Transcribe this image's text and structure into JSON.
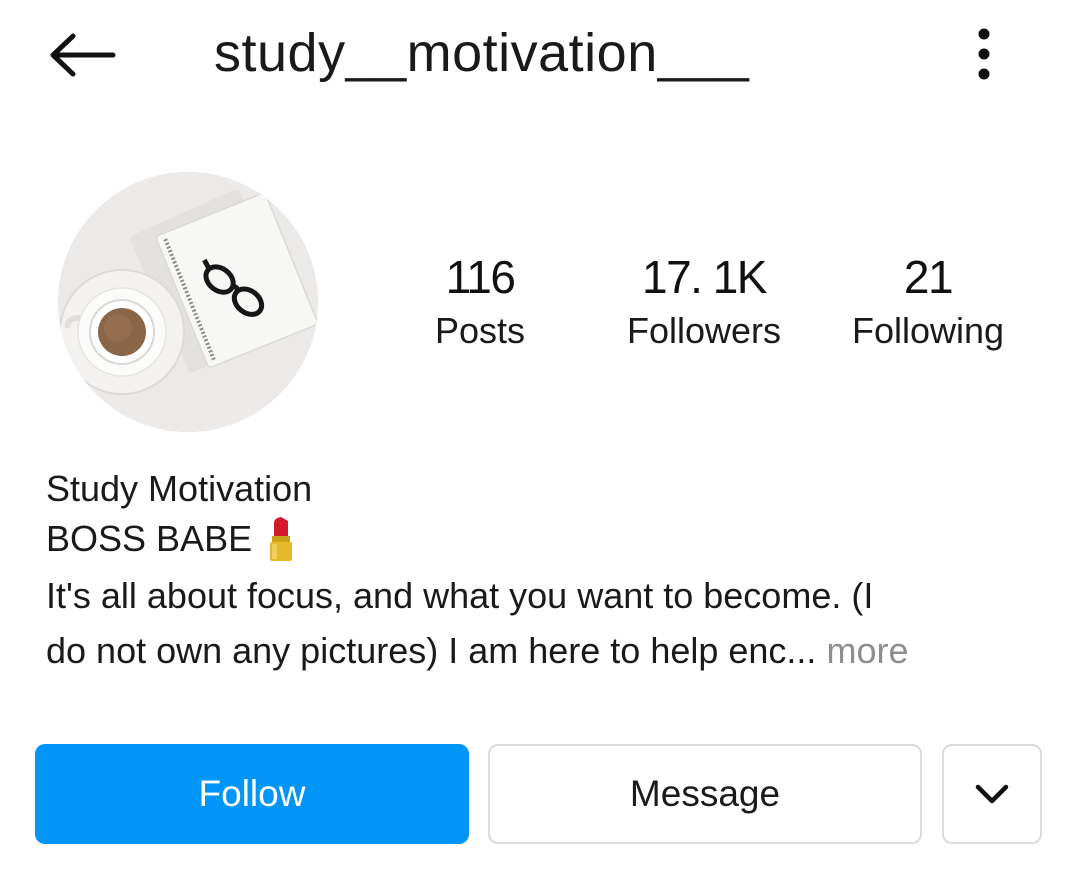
{
  "header": {
    "username": "study__motivation___",
    "back_icon": "arrow-left-icon",
    "menu_icon": "vertical-dots-icon"
  },
  "profile": {
    "avatar_icon": "avatar-photo",
    "stats": [
      {
        "value": "116",
        "label": "Posts"
      },
      {
        "value": "17. 1K",
        "label": "Followers"
      },
      {
        "value": "21",
        "label": "Following"
      }
    ]
  },
  "bio": {
    "name": "Study Motivation",
    "tagline": "BOSS BABE",
    "tagline_icon": "lipstick-icon",
    "line1": "It's all about focus,  and what you want to become.  (I",
    "line2": "do not own any pictures) I am here to help enc...",
    "more_label": "more"
  },
  "actions": {
    "follow_label": "Follow",
    "message_label": "Message",
    "dropdown_icon": "chevron-down-icon"
  },
  "colors": {
    "accent": "#0095f6",
    "border": "#dbdbdb",
    "muted": "#8e8e8e",
    "text": "#1a1a1a"
  }
}
